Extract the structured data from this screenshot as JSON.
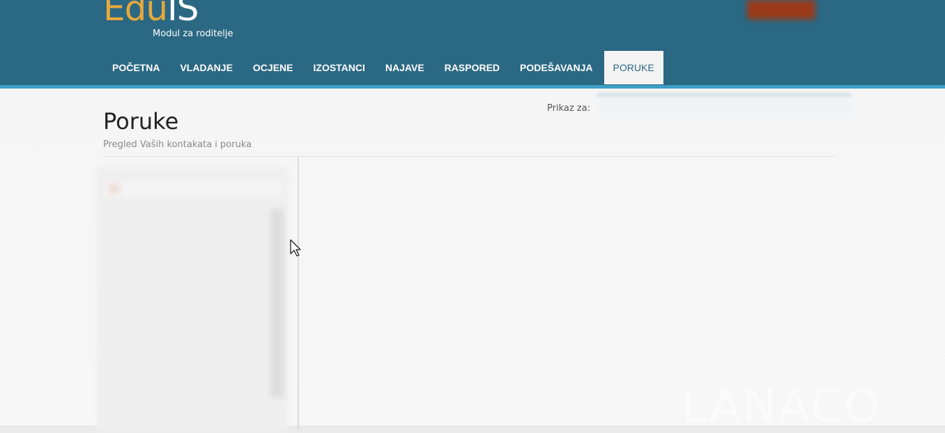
{
  "brand": {
    "logo_part1": "Edu",
    "logo_part2": "IS",
    "subtitle": "Modul za roditelje"
  },
  "nav": {
    "items": [
      {
        "label": "POČETNA"
      },
      {
        "label": "VLADANJE"
      },
      {
        "label": "OCJENE"
      },
      {
        "label": "IZOSTANCI"
      },
      {
        "label": "NAJAVE"
      },
      {
        "label": "RASPORED"
      },
      {
        "label": "PODEŠAVANJA"
      },
      {
        "label": "PORUKE",
        "active": true
      }
    ]
  },
  "page": {
    "title": "Poruke",
    "subtitle": "Pregled Vaših kontakata i poruka",
    "prikaz_label": "Prikaz za:"
  },
  "watermark": "LANACO",
  "colors": {
    "header_bg": "#2b6883",
    "header_stripe": "#3c9fc6",
    "logo_accent": "#e6a93c",
    "alert_button": "#9a3a1a"
  },
  "cursor_icon": "arrow-cursor-icon"
}
